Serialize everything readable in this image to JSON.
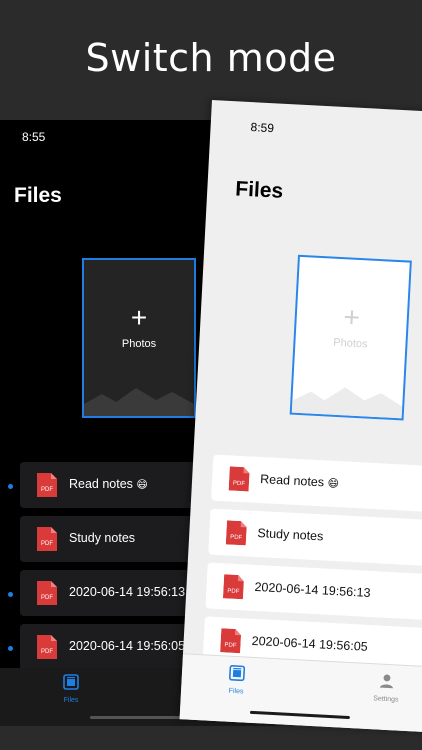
{
  "headline": "Switch mode",
  "colors": {
    "accent": "#1e7ee6",
    "pdf_red": "#d93a3a",
    "dark_bg": "#000000",
    "light_bg": "#efefef"
  },
  "dark_phone": {
    "status_time": "8:55",
    "title": "Files",
    "tile": {
      "plus": "+",
      "label": "Photos"
    },
    "files": [
      {
        "name": "Read notes",
        "emoji": "😄",
        "icon": "pdf-icon",
        "icon_text": "PDF",
        "unread": true
      },
      {
        "name": "Study notes",
        "emoji": "",
        "icon": "pdf-icon",
        "icon_text": "PDF",
        "unread": false
      },
      {
        "name": "2020-06-14 19:56:13",
        "emoji": "",
        "icon": "pdf-icon",
        "icon_text": "PDF",
        "unread": true
      },
      {
        "name": "2020-06-14 19:56:05",
        "emoji": "",
        "icon": "pdf-icon",
        "icon_text": "PDF",
        "unread": true
      }
    ],
    "tabs": {
      "files": "Files"
    }
  },
  "light_phone": {
    "status_time": "8:59",
    "title": "Files",
    "tile": {
      "plus": "+",
      "label": "Photos"
    },
    "files": [
      {
        "name": "Read notes",
        "emoji": "😄",
        "icon": "pdf-icon",
        "icon_text": "PDF"
      },
      {
        "name": "Study notes",
        "emoji": "",
        "icon": "pdf-icon",
        "icon_text": "PDF"
      },
      {
        "name": "2020-06-14 19:56:13",
        "emoji": "",
        "icon": "pdf-icon",
        "icon_text": "PDF"
      },
      {
        "name": "2020-06-14 19:56:05",
        "emoji": "",
        "icon": "pdf-icon",
        "icon_text": "PDF"
      }
    ],
    "tabs": {
      "files": "Files",
      "settings": "Settings"
    }
  }
}
